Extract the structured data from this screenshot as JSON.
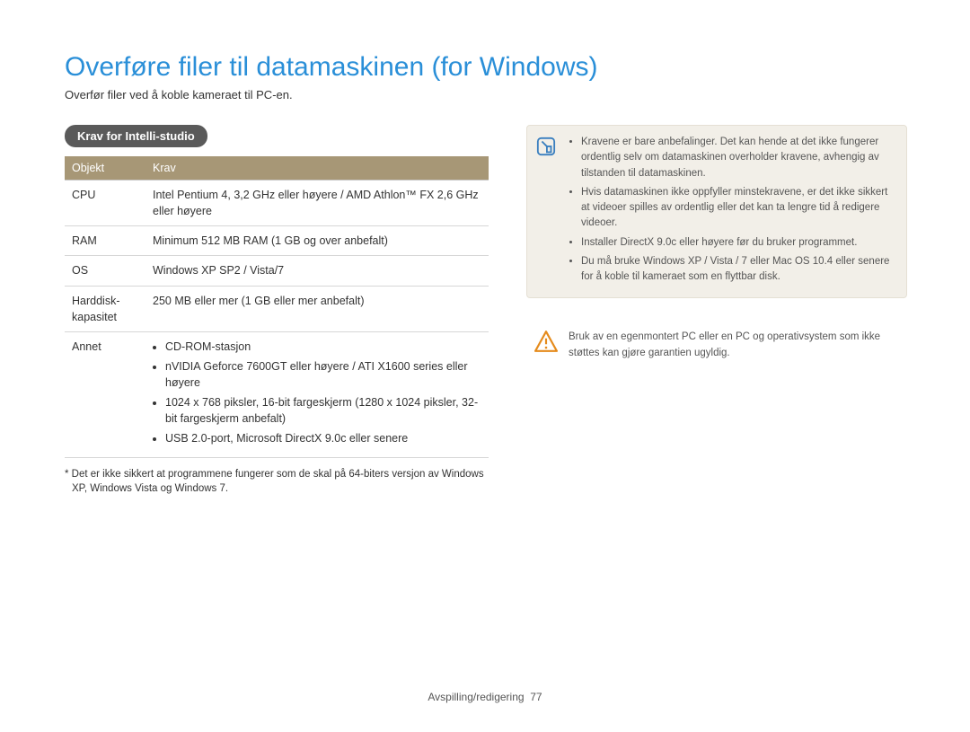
{
  "title": "Overføre filer til datamaskinen (for Windows)",
  "subtitle": "Overfør filer ved å koble kameraet til PC-en.",
  "section_pill": "Krav for Intelli-studio",
  "table": {
    "headers": {
      "col1": "Objekt",
      "col2": "Krav"
    },
    "rows": {
      "cpu": {
        "label": "CPU",
        "value": "Intel Pentium 4, 3,2 GHz eller høyere / AMD Athlon™ FX 2,6 GHz eller høyere"
      },
      "ram": {
        "label": "RAM",
        "value": "Minimum 512 MB RAM (1 GB og over anbefalt)"
      },
      "os": {
        "label": "OS",
        "value": "Windows XP SP2 / Vista/7"
      },
      "hdd": {
        "label": "Harddisk-kapasitet",
        "value": "250 MB eller mer (1 GB eller mer anbefalt)"
      },
      "other": {
        "label": "Annet",
        "items": [
          "CD-ROM-stasjon",
          "nVIDIA Geforce 7600GT eller høyere / ATI X1600 series eller høyere",
          "1024 x 768 piksler, 16-bit fargeskjerm (1280 x 1024 piksler, 32-bit fargeskjerm anbefalt)",
          "USB 2.0-port, Microsoft DirectX 9.0c eller senere"
        ]
      }
    }
  },
  "footnote": "* Det er ikke sikkert at programmene fungerer som de skal på 64-biters versjon av Windows XP, Windows Vista og Windows 7.",
  "note_box": {
    "items": [
      "Kravene er bare anbefalinger. Det kan hende at det ikke fungerer ordentlig selv om datamaskinen overholder kravene, avhengig av tilstanden til datamaskinen.",
      "Hvis datamaskinen ikke oppfyller minstekravene, er det ikke sikkert at videoer spilles av ordentlig eller det kan ta lengre tid å redigere videoer.",
      "Installer DirectX 9.0c eller høyere før du bruker programmet.",
      "Du må bruke Windows XP / Vista / 7 eller Mac OS 10.4 eller senere for å koble til kameraet som en flyttbar disk."
    ]
  },
  "warn_box": {
    "text": "Bruk av en egenmontert PC eller en PC og operativsystem som ikke støttes kan gjøre garantien ugyldig."
  },
  "footer": {
    "section": "Avspilling/redigering",
    "page": "77"
  }
}
